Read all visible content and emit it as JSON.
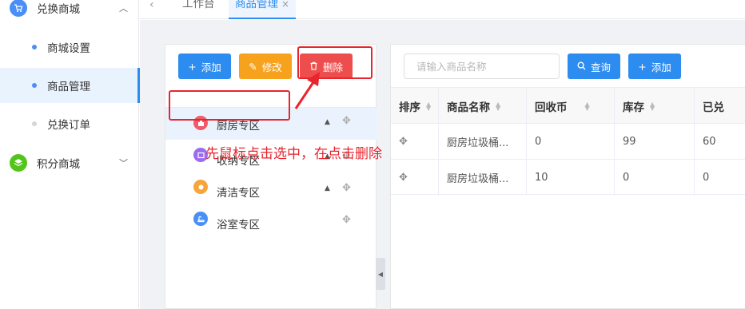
{
  "sidebar": {
    "groups": [
      {
        "label": "兑换商城",
        "icon": "cart-icon",
        "color": "#4a8ff7",
        "expanded": true
      },
      {
        "label": "积分商城",
        "icon": "layers-icon",
        "color": "#52c41a",
        "expanded": false
      }
    ],
    "items": [
      {
        "label": "商城设置",
        "active": false
      },
      {
        "label": "商品管理",
        "active": true
      },
      {
        "label": "兑换订单",
        "active": false
      }
    ]
  },
  "tabs": {
    "back_icon": "chevron-left-icon",
    "items": [
      {
        "label": "工作台",
        "active": false
      },
      {
        "label": "商品管理",
        "active": true,
        "close": "×"
      }
    ]
  },
  "left_panel": {
    "add_label": "添加",
    "edit_label": "修改",
    "delete_label": "删除",
    "tree": [
      {
        "label": "厨房专区",
        "selected": true,
        "icon_color": "#f05a6a",
        "has_up": true
      },
      {
        "label": "收纳专区",
        "selected": false,
        "icon_color": "#9b6cf0",
        "has_up": true
      },
      {
        "label": "清洁专区",
        "selected": false,
        "icon_color": "#f7a53a",
        "has_up": true
      },
      {
        "label": "浴室专区",
        "selected": false,
        "icon_color": "#4a8ff7",
        "has_up": false
      }
    ]
  },
  "right_panel": {
    "search_placeholder": "请输入商品名称",
    "query_label": "查询",
    "add_label": "添加",
    "columns": [
      "排序",
      "商品名称",
      "回收币",
      "库存",
      "已兑"
    ],
    "rows": [
      [
        "✥",
        "厨房垃圾桶...",
        "0",
        "99",
        "60"
      ],
      [
        "✥",
        "厨房垃圾桶...",
        "10",
        "0",
        "0"
      ]
    ]
  },
  "annotation": {
    "text": "先鼠标点击选中，在点击删除",
    "color": "#e8242d"
  }
}
